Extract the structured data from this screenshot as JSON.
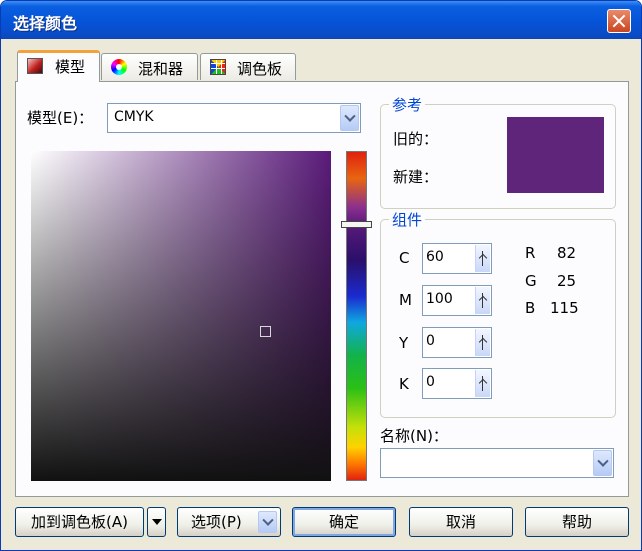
{
  "window": {
    "title": "选择颜色"
  },
  "tabs": [
    {
      "label": "模型",
      "icon": "color-model-icon"
    },
    {
      "label": "混和器",
      "icon": "color-wheel-icon"
    },
    {
      "label": "调色板",
      "icon": "palette-grid-icon"
    }
  ],
  "model": {
    "label": "模型(E)：",
    "value": "CMYK"
  },
  "reference": {
    "title": "参考",
    "old_label": "旧的：",
    "new_label": "新建：",
    "swatch_color": "#5f257a"
  },
  "components": {
    "title": "组件",
    "cmyk": [
      {
        "label": "C",
        "value": "60"
      },
      {
        "label": "M",
        "value": "100"
      },
      {
        "label": "Y",
        "value": "0"
      },
      {
        "label": "K",
        "value": "0"
      }
    ],
    "rgb": [
      {
        "label": "R",
        "value": "82"
      },
      {
        "label": "G",
        "value": "25"
      },
      {
        "label": "B",
        "value": "115"
      }
    ]
  },
  "name": {
    "label": "名称(N)：",
    "value": ""
  },
  "buttons": {
    "add_to_palette": "加到调色板(A)",
    "options": "选项(P)",
    "ok": "确定",
    "cancel": "取消",
    "help": "帮助"
  },
  "colors": {
    "titlebar": "#0553d8",
    "current_color": "#5f257a",
    "group_title": "#0046d5"
  }
}
